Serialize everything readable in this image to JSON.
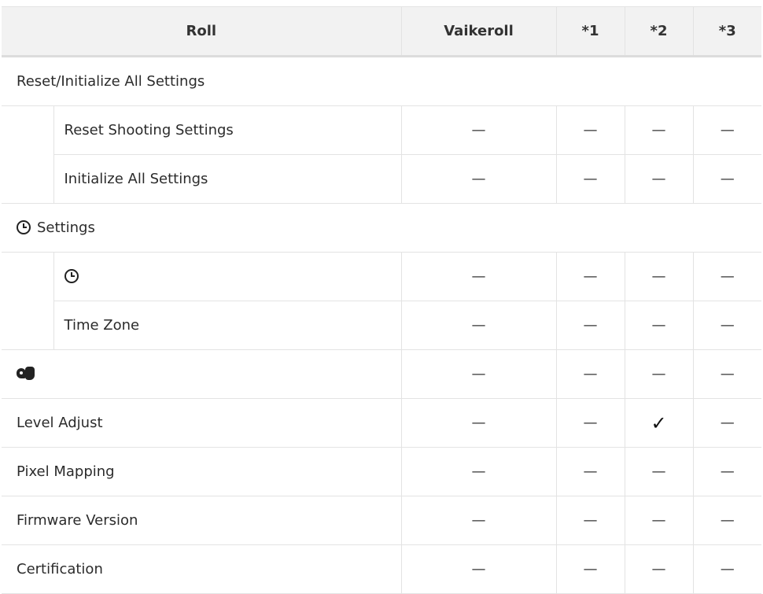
{
  "headers": {
    "roll": "Roll",
    "vaikeroll": "Vaikeroll",
    "col1": "*1",
    "col2": "*2",
    "col3": "*3"
  },
  "dash": "—",
  "check": "✓",
  "sections": {
    "reset": {
      "title": "Reset/Initialize All Settings",
      "items": [
        {
          "label": "Reset Shooting Settings"
        },
        {
          "label": "Initialize All Settings"
        }
      ]
    },
    "clock": {
      "icon": "clock-icon",
      "title": "Settings",
      "items": [
        {
          "icon": "clock-icon"
        },
        {
          "label": "Time Zone"
        }
      ]
    }
  },
  "rows": {
    "language_icon": "language-icon",
    "level_adjust": "Level Adjust",
    "pixel_mapping": "Pixel Mapping",
    "firmware_version": "Firmware Version",
    "certification": "Certification"
  }
}
